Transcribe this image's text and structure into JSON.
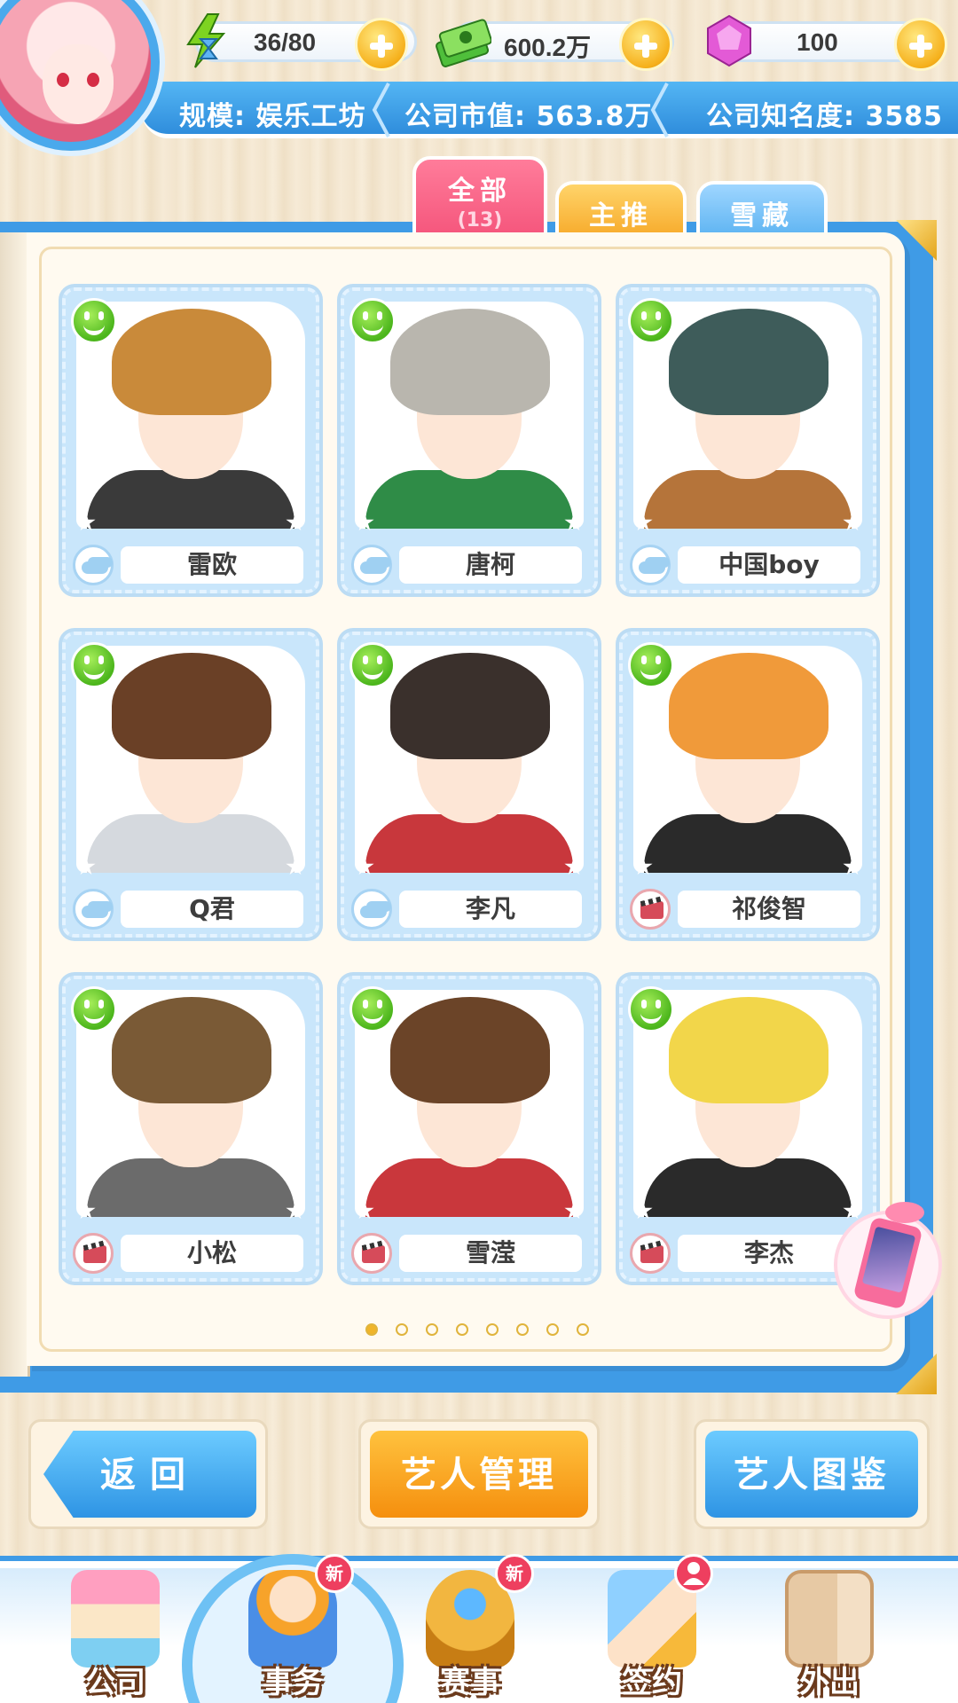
{
  "resources": {
    "energy": "36/80",
    "money": "600.2万",
    "gems": "100"
  },
  "company_info": {
    "scale": "规模: 娱乐工坊",
    "market_value": "公司市值: 563.8万",
    "fame": "公司知名度: 3585"
  },
  "tabs": {
    "all_label": "全部",
    "all_count": "(13)",
    "featured_label": "主推",
    "frozen_label": "雪藏"
  },
  "artists": [
    {
      "name": "雷欧",
      "type_icon": "cloud-icon"
    },
    {
      "name": "唐柯",
      "type_icon": "cloud-icon"
    },
    {
      "name": "中国boy",
      "type_icon": "cloud-icon"
    },
    {
      "name": "Q君",
      "type_icon": "cloud-icon"
    },
    {
      "name": "李凡",
      "type_icon": "cloud-icon"
    },
    {
      "name": "祁俊智",
      "type_icon": "film-clapper-icon"
    },
    {
      "name": "小松",
      "type_icon": "film-clapper-icon"
    },
    {
      "name": "雪滢",
      "type_icon": "film-clapper-icon"
    },
    {
      "name": "李杰",
      "type_icon": "film-clapper-icon"
    }
  ],
  "pagination": {
    "current_page": 1,
    "total_pages": 8
  },
  "actions": {
    "back": "返回",
    "manage": "艺人管理",
    "catalog": "艺人图鉴"
  },
  "nav": {
    "company": "公司",
    "affairs": "事务",
    "contest": "赛事",
    "sign": "签约",
    "outing": "外出",
    "new_badge": "新"
  },
  "colors": {
    "primary_blue": "#3f9be6",
    "tab_pink": "#f4537a",
    "tab_orange": "#f7ab2c",
    "accent_orange": "#f58f0e",
    "status_green": "#4cb61c"
  }
}
